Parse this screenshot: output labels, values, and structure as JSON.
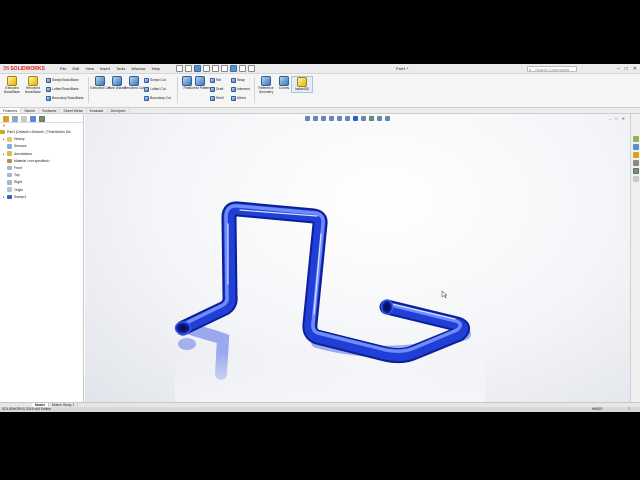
{
  "app": {
    "brand_prefix": "3S",
    "brand": "SOLIDWORKS",
    "document_title": "Part1 *",
    "search_placeholder": "Search Commands",
    "window_buttons": [
      "–",
      "□",
      "✕"
    ]
  },
  "menu": [
    "File",
    "Edit",
    "View",
    "Insert",
    "Tools",
    "Window",
    "Help"
  ],
  "ribbon": {
    "extruded_boss": "Extruded Boss/Base",
    "revolved_boss": "Revolved Boss/Base",
    "swept_boss": "Swept Boss/Base",
    "lofted_boss": "Lofted Boss/Base",
    "boundary_boss": "Boundary Boss/Base",
    "extruded_cut": "Extruded Cut",
    "hole_wizard": "Hole Wizard",
    "revolved_cut": "Revolved Cut",
    "swept_cut": "Swept Cut",
    "lofted_cut": "Lofted Cut",
    "boundary_cut": "Boundary Cut",
    "fillet": "Fillet",
    "linear_pattern": "Linear Pattern",
    "rib": "Rib",
    "draft": "Draft",
    "shell": "Shell",
    "wrap": "Wrap",
    "intersect": "Intersect",
    "mirror": "Mirror",
    "reference_geometry": "Reference Geometry",
    "curves": "Curves",
    "instant3d": "Instant3D"
  },
  "command_tabs": [
    "Features",
    "Sketch",
    "Surfaces",
    "Sheet Metal",
    "Evaluate",
    "DimXpert"
  ],
  "tree": {
    "root": "Part1 (Default<<Default>_PhotoWorks Dis",
    "items": [
      {
        "label": "History",
        "icon": "history-icon",
        "expand": "▸"
      },
      {
        "label": "Sensors",
        "icon": "sensor-icon",
        "expand": ""
      },
      {
        "label": "Annotations",
        "icon": "annotation-icon",
        "expand": "▸"
      },
      {
        "label": "Material <not specified>",
        "icon": "material-icon",
        "expand": ""
      },
      {
        "label": "Front",
        "icon": "plane-icon",
        "expand": ""
      },
      {
        "label": "Top",
        "icon": "plane-icon",
        "expand": ""
      },
      {
        "label": "Right",
        "icon": "plane-icon",
        "expand": ""
      },
      {
        "label": "Origin",
        "icon": "origin-icon",
        "expand": ""
      },
      {
        "label": "Sweep1",
        "icon": "sweep-feature-icon",
        "expand": "▸"
      }
    ]
  },
  "bottom_tabs": [
    "Model",
    "Motion Study 1"
  ],
  "status": {
    "edition": "SOLIDWORKS 2016 x64 Edition",
    "units": "MMGS",
    "help": "?"
  },
  "colors": {
    "model_blue": "#1f3fd6",
    "brand_red": "#d9261c"
  }
}
